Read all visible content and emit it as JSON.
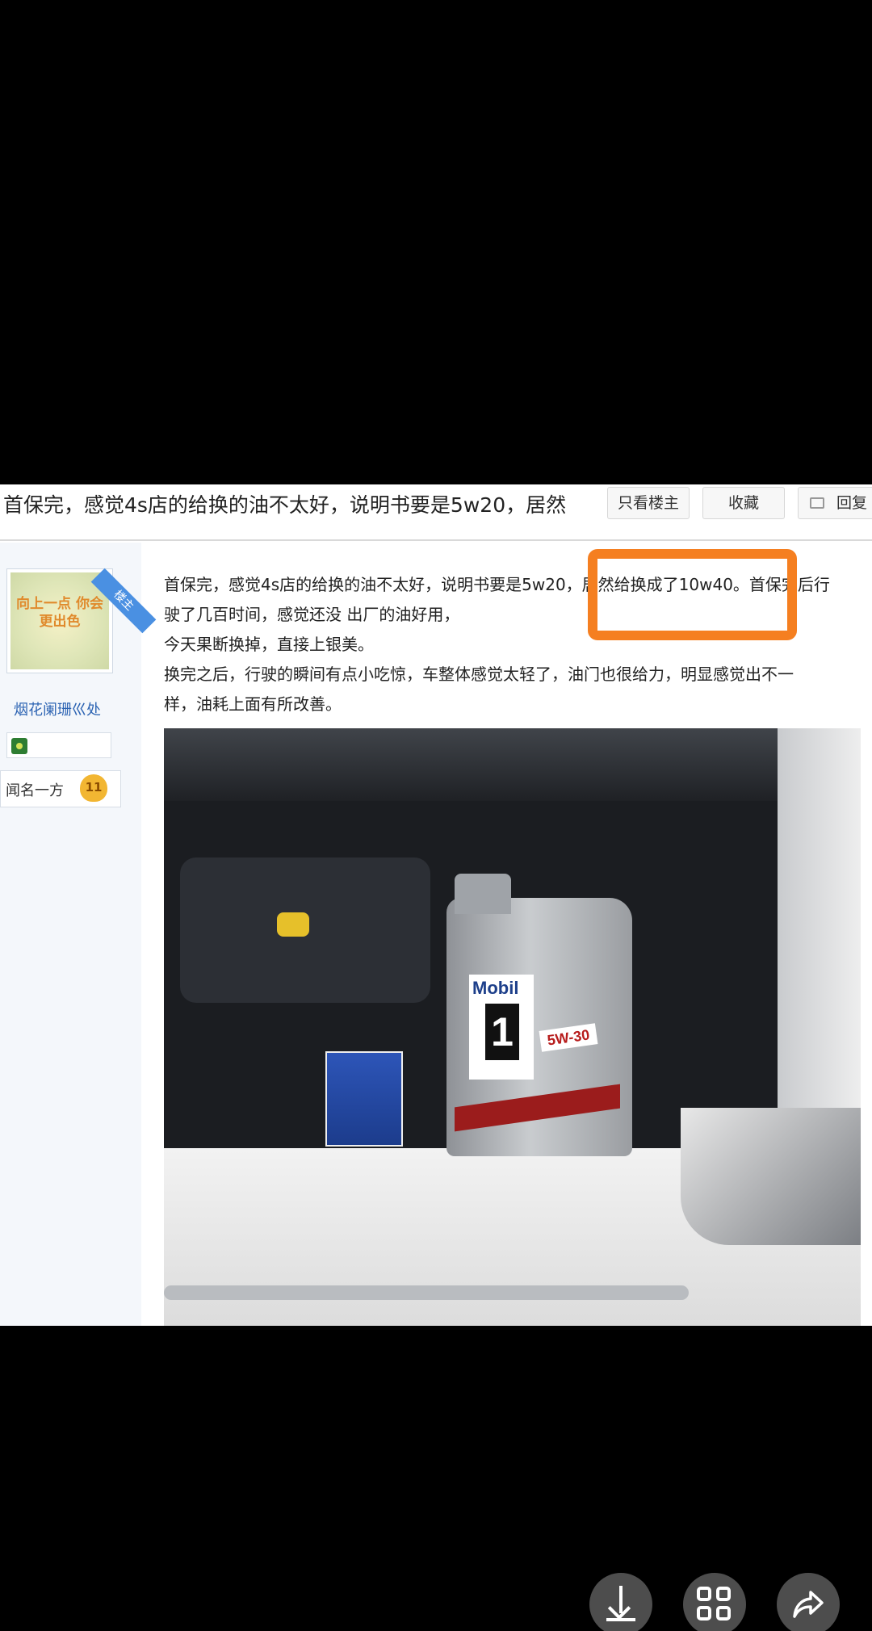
{
  "thread": {
    "title": "首保完，感觉4s店的给换的油不太好，说明书要是5w20，居然",
    "buttons": {
      "owner_only": "只看楼主",
      "favorite": "收藏",
      "reply": "回复"
    }
  },
  "user": {
    "owner_badge": "楼主",
    "avatar_text": "向上一点 你会更出色",
    "name": "烟花阑珊巛处",
    "rank_label": "闻名一方",
    "rank_level": "11"
  },
  "post": {
    "lines": [
      "首保完，感觉4s店的给换的油不太好，说明书要是5w20，居然给换成了10w40。首保完后行",
      "驶了几百时间，感觉还没 出厂的油好用，",
      "今天果断换掉，直接上银美。",
      "换完之后，行驶的瞬间有点小吃惊，车整体感觉太轻了，油门也很给力，明显感觉出不一",
      "样，油耗上面有所改善。"
    ],
    "highlight": "居然给换成了10w40。",
    "photo": {
      "brand": "Mobil",
      "number": "1",
      "grade": "5W-30"
    }
  },
  "colors": {
    "highlight_border": "#f57f20",
    "username": "#2d64b3",
    "badge": "#4a90e2"
  },
  "icons": [
    "reply-icon",
    "level-icon",
    "rank-heart-icon",
    "download-icon",
    "grid-icon",
    "share-icon"
  ]
}
